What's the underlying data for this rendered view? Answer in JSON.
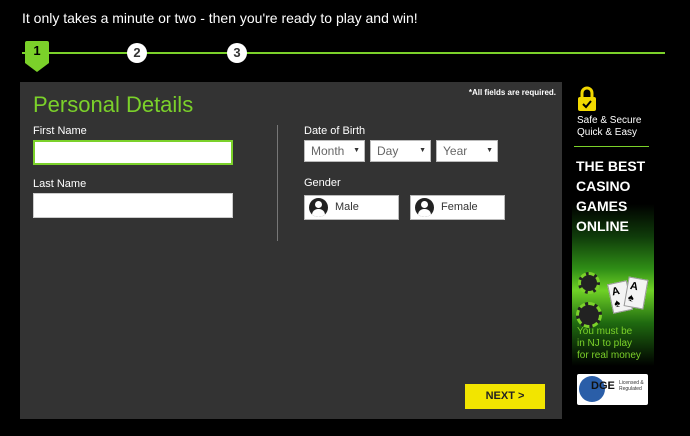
{
  "intro": "It only takes a minute or two - then you're ready to play and win!",
  "steps": [
    "1",
    "2",
    "3"
  ],
  "form": {
    "title": "Personal Details",
    "required_note": "*All fields are required.",
    "first_name_label": "First Name",
    "last_name_label": "Last Name",
    "dob_label": "Date of Birth",
    "month": "Month",
    "day": "Day",
    "year": "Year",
    "gender_label": "Gender",
    "male": "Male",
    "female": "Female",
    "next": "NEXT >"
  },
  "sidebar": {
    "secure_line1": "Safe & Secure",
    "secure_line2": "Quick & Easy",
    "promo_line1": "THE BEST",
    "promo_line2": "CASINO",
    "promo_line3": "GAMES",
    "promo_line4": "ONLINE",
    "note_line1": "You must be",
    "note_line2": "in NJ to play",
    "note_line3": "for real money",
    "dge": "DGE",
    "dge_small1": "Licensed &",
    "dge_small2": "Regulated"
  },
  "colors": {
    "accent": "#7bd12a",
    "panel": "#333333",
    "next_button": "#f2e500"
  },
  "icons": [
    "lock-icon",
    "user-icon",
    "chevron-down-icon"
  ]
}
